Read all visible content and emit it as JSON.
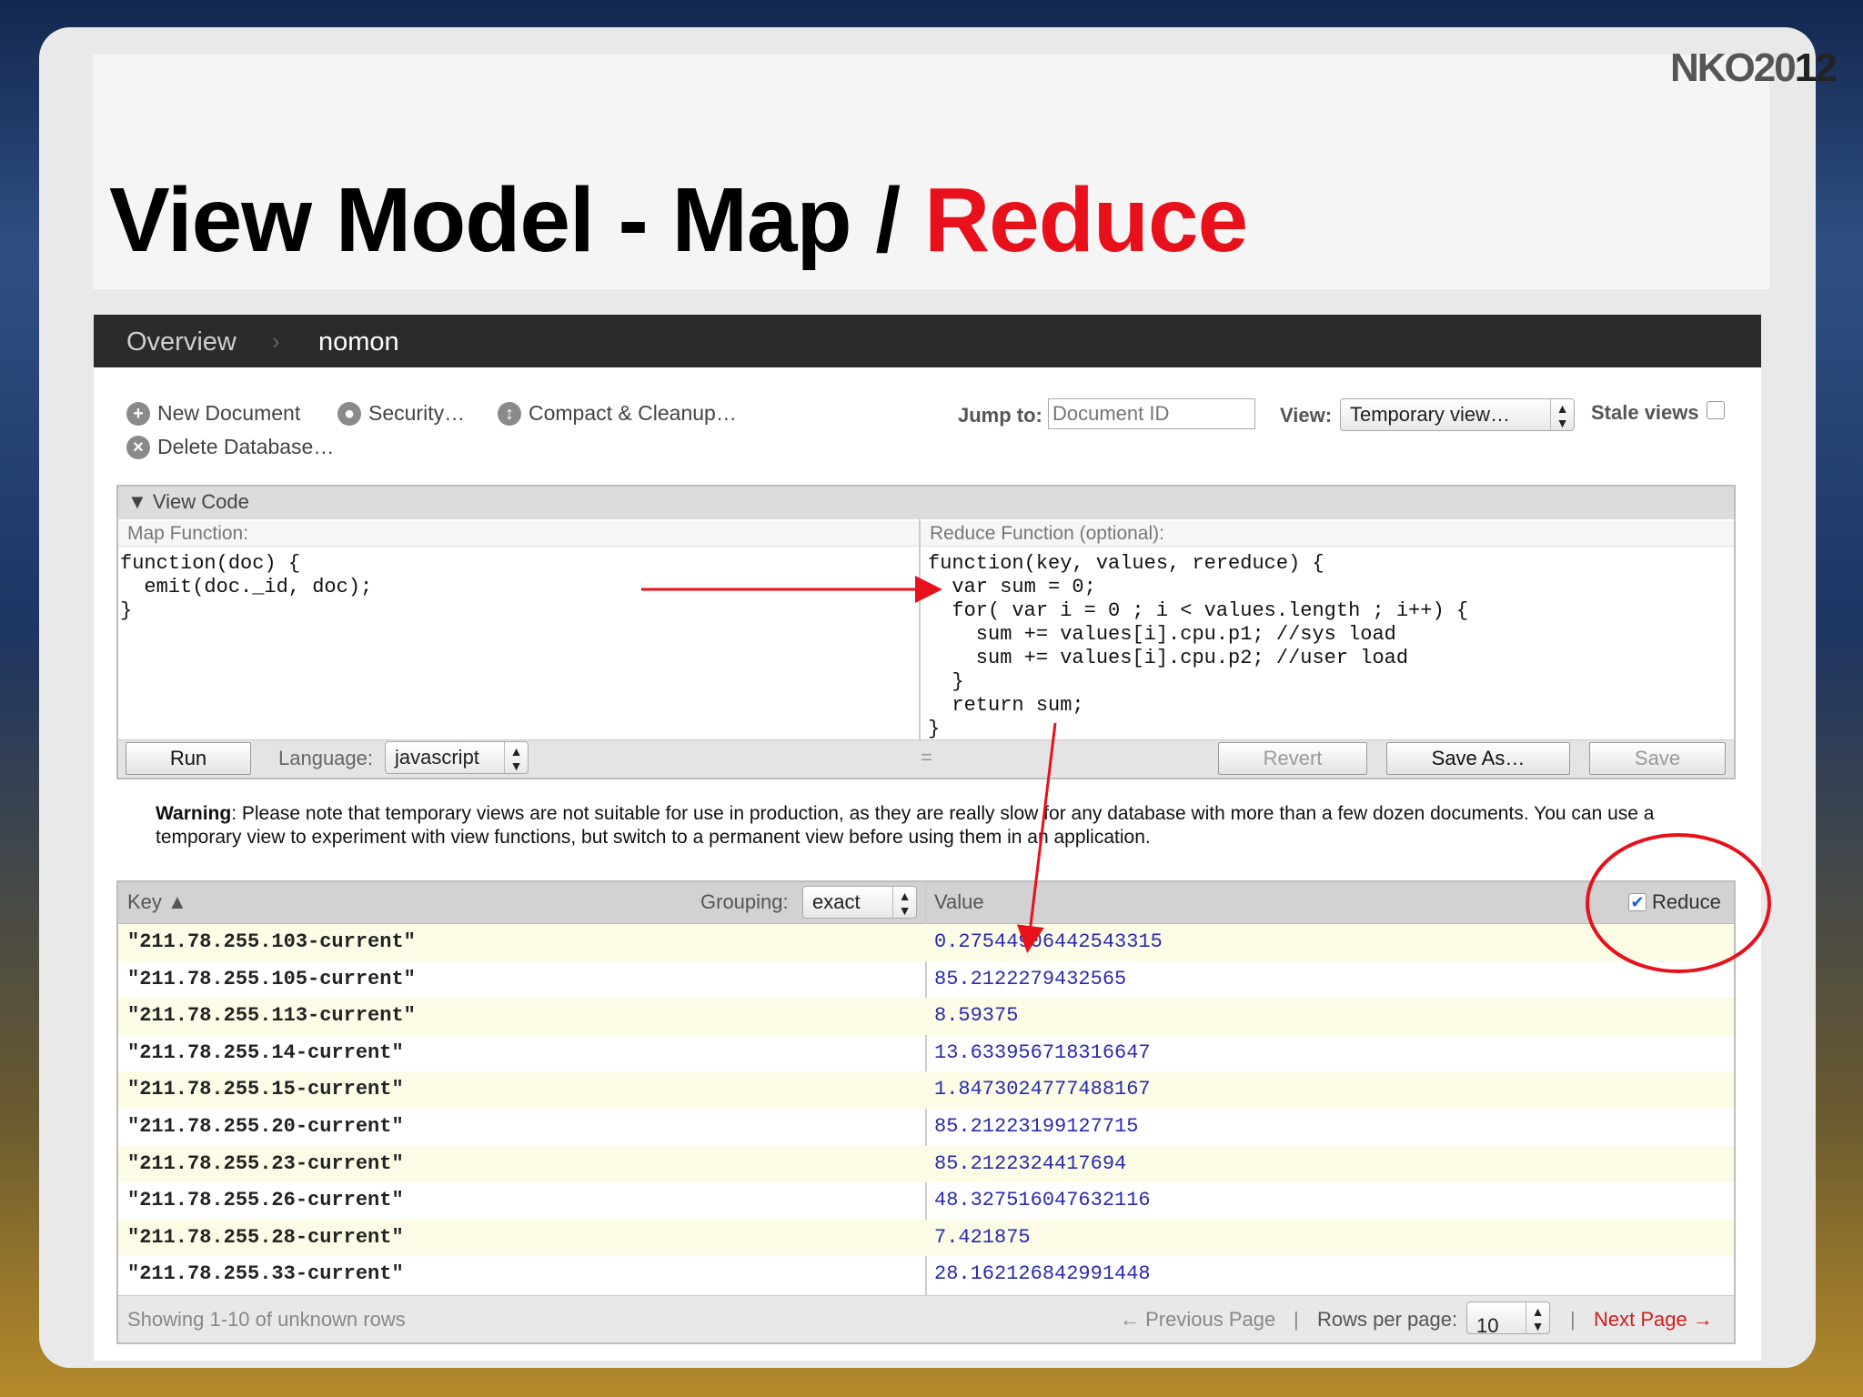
{
  "slide": {
    "title_main": "View Model - Map / ",
    "title_accent": "Reduce",
    "logo_a": "NKO20",
    "logo_b": "12"
  },
  "topbar": {
    "crumb_root": "Overview",
    "crumb_sep": "›",
    "crumb_current": "nomon"
  },
  "actions": {
    "new_document": "New Document",
    "security": "Security…",
    "compact": "Compact & Cleanup…",
    "delete_db": "Delete Database…",
    "jump_label": "Jump to:",
    "jump_placeholder": "Document ID",
    "view_label": "View:",
    "view_value": "Temporary view…",
    "stale_label": "Stale views"
  },
  "code_panel": {
    "header": "▼ View Code",
    "map_label": "Map Function:",
    "reduce_label": "Reduce Function (optional):",
    "map_code": "function(doc) {\n  emit(doc._id, doc);\n}",
    "reduce_code": "function(key, values, rereduce) {\n  var sum = 0;\n  for( var i = 0 ; i < values.length ; i++) {\n    sum += values[i].cpu.p1; //sys load\n    sum += values[i].cpu.p2; //user load\n  }\n  return sum;\n}",
    "run": "Run",
    "language_label": "Language:",
    "language_value": "javascript",
    "resize": "=",
    "revert": "Revert",
    "save_as": "Save As…",
    "save": "Save"
  },
  "warning": {
    "bold": "Warning",
    "text": ": Please note that temporary views are not suitable for use in production, as they are really slow for any database with more than a few dozen documents. You can use a temporary view to experiment with view functions, but switch to a permanent view before using them in an application."
  },
  "results": {
    "key_header": "Key ▲",
    "grouping_label": "Grouping:",
    "grouping_value": "exact",
    "value_header": "Value",
    "reduce_label": "Reduce",
    "reduce_checked": true,
    "rows": [
      {
        "key": "\"211.78.255.103-current\"",
        "value": "0.27544906442543315"
      },
      {
        "key": "\"211.78.255.105-current\"",
        "value": "85.2122279432565"
      },
      {
        "key": "\"211.78.255.113-current\"",
        "value": "8.59375"
      },
      {
        "key": "\"211.78.255.14-current\"",
        "value": "13.633956718316647"
      },
      {
        "key": "\"211.78.255.15-current\"",
        "value": "1.8473024777488167"
      },
      {
        "key": "\"211.78.255.20-current\"",
        "value": "85.21223199127715"
      },
      {
        "key": "\"211.78.255.23-current\"",
        "value": "85.2122324417694"
      },
      {
        "key": "\"211.78.255.26-current\"",
        "value": "48.327516047632116"
      },
      {
        "key": "\"211.78.255.28-current\"",
        "value": "7.421875"
      },
      {
        "key": "\"211.78.255.33-current\"",
        "value": "28.162126842991448"
      }
    ],
    "showing": "Showing 1-10 of unknown rows",
    "prev": "← Previous Page",
    "sep1": "|",
    "rows_per_page_label": "Rows per page:",
    "rows_per_page": "10",
    "sep2": "|",
    "next": "Next Page →"
  },
  "colors": {
    "annotation": "#e8101a",
    "value_text": "#2a2ab0"
  }
}
